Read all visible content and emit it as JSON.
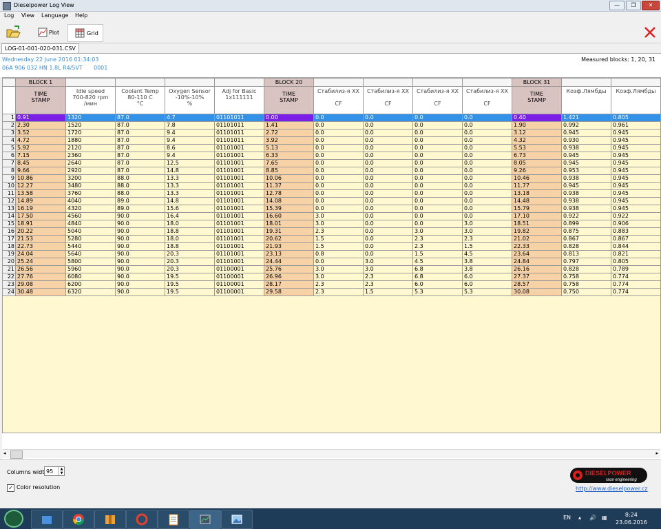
{
  "window": {
    "title": "Dieselpower Log View",
    "minimize": "—",
    "maximize": "❐",
    "close": "✕"
  },
  "menu": [
    "Log",
    "View",
    "Language",
    "Help"
  ],
  "toolbar": {
    "plot": "Plot",
    "grid": "Grid"
  },
  "file_tab": "LOG-01-001-020-031.CSV",
  "info": {
    "date": "Wednesday 22 June 2016 01:34:03",
    "engine": "06A 906 032 HN  1.8L R4/5VT",
    "code": "0001",
    "measured": "Measured blocks: 1, 20, 31"
  },
  "colors": {
    "accent": "#3391e8",
    "timestamp_cell": "#f6d2a6",
    "block_header": "#d9c3c0",
    "selected_ts": "#7b1fe6",
    "value_cell": "#fff8d0"
  },
  "grid": {
    "blocks": {
      "b1": "BLOCK 1",
      "b20": "BLOCK 20",
      "b31": "BLOCK 31"
    },
    "headers": [
      [
        "TIME",
        "STAMP",
        ""
      ],
      [
        "Idle speed",
        "700-820 rpm",
        "/мин"
      ],
      [
        "Coolant Temp",
        "80-110 C",
        "°C"
      ],
      [
        "Oxygen Sensor",
        "-10%-10%",
        "%"
      ],
      [
        "Adj for Basic",
        "1x111111",
        ""
      ],
      [
        "TIME",
        "STAMP",
        ""
      ],
      [
        "Стабилиз-я ХХ",
        "",
        "CF"
      ],
      [
        "Стабилиз-я ХХ",
        "",
        "CF"
      ],
      [
        "Стабилиз-я ХХ",
        "",
        "CF"
      ],
      [
        "Стабилиз-я ХХ",
        "",
        "CF"
      ],
      [
        "TIME",
        "STAMP",
        ""
      ],
      [
        "Коэф.Лямбды",
        "",
        ""
      ],
      [
        "Коэф.Лямбды",
        "",
        ""
      ]
    ],
    "rows": [
      [
        "1",
        "0.91",
        "1320",
        "87.0",
        "4.7",
        "01101011",
        "0.00",
        "0.0",
        "0.0",
        "0.0",
        "0.0",
        "0.40",
        "1.421",
        "0.805"
      ],
      [
        "2",
        "2.30",
        "1520",
        "87.0",
        "7.8",
        "01101011",
        "1.41",
        "0.0",
        "0.0",
        "0.0",
        "0.0",
        "1.90",
        "0.992",
        "0.961"
      ],
      [
        "3",
        "3.52",
        "1720",
        "87.0",
        "9.4",
        "01101011",
        "2.72",
        "0.0",
        "0.0",
        "0.0",
        "0.0",
        "3.12",
        "0.945",
        "0.945"
      ],
      [
        "4",
        "4.72",
        "1880",
        "87.0",
        "9.4",
        "01101011",
        "3.92",
        "0.0",
        "0.0",
        "0.0",
        "0.0",
        "4.32",
        "0.930",
        "0.945"
      ],
      [
        "5",
        "5.92",
        "2120",
        "87.0",
        "8.6",
        "01101001",
        "5.13",
        "0.0",
        "0.0",
        "0.0",
        "0.0",
        "5.53",
        "0.938",
        "0.945"
      ],
      [
        "6",
        "7.15",
        "2360",
        "87.0",
        "9.4",
        "01101001",
        "6.33",
        "0.0",
        "0.0",
        "0.0",
        "0.0",
        "6.73",
        "0.945",
        "0.945"
      ],
      [
        "7",
        "8.45",
        "2640",
        "87.0",
        "12.5",
        "01101001",
        "7.65",
        "0.0",
        "0.0",
        "0.0",
        "0.0",
        "8.05",
        "0.945",
        "0.945"
      ],
      [
        "8",
        "9.66",
        "2920",
        "87.0",
        "14.8",
        "01101001",
        "8.85",
        "0.0",
        "0.0",
        "0.0",
        "0.0",
        "9.26",
        "0.953",
        "0.945"
      ],
      [
        "9",
        "10.86",
        "3200",
        "88.0",
        "13.3",
        "01101001",
        "10.06",
        "0.0",
        "0.0",
        "0.0",
        "0.0",
        "10.46",
        "0.938",
        "0.945"
      ],
      [
        "10",
        "12.27",
        "3480",
        "88.0",
        "13.3",
        "01101001",
        "11.37",
        "0.0",
        "0.0",
        "0.0",
        "0.0",
        "11.77",
        "0.945",
        "0.945"
      ],
      [
        "11",
        "13.58",
        "3760",
        "88.0",
        "13.3",
        "01101001",
        "12.78",
        "0.0",
        "0.0",
        "0.0",
        "0.0",
        "13.18",
        "0.938",
        "0.945"
      ],
      [
        "12",
        "14.89",
        "4040",
        "89.0",
        "14.8",
        "01101001",
        "14.08",
        "0.0",
        "0.0",
        "0.0",
        "0.0",
        "14.48",
        "0.938",
        "0.945"
      ],
      [
        "13",
        "16.19",
        "4320",
        "89.0",
        "15.6",
        "01101001",
        "15.39",
        "0.0",
        "0.0",
        "0.0",
        "0.0",
        "15.79",
        "0.938",
        "0.945"
      ],
      [
        "14",
        "17.50",
        "4560",
        "90.0",
        "16.4",
        "01101001",
        "16.60",
        "3.0",
        "0.0",
        "0.0",
        "0.0",
        "17.10",
        "0.922",
        "0.922"
      ],
      [
        "15",
        "18.91",
        "4840",
        "90.0",
        "18.0",
        "01101001",
        "18.01",
        "3.0",
        "0.0",
        "0.0",
        "3.0",
        "18.51",
        "0.899",
        "0.906"
      ],
      [
        "16",
        "20.22",
        "5040",
        "90.0",
        "18.8",
        "01101001",
        "19.31",
        "2.3",
        "0.0",
        "3.0",
        "3.0",
        "19.82",
        "0.875",
        "0.883"
      ],
      [
        "17",
        "21.53",
        "5280",
        "90.0",
        "18.0",
        "01101001",
        "20.62",
        "1.5",
        "0.0",
        "2.3",
        "2.3",
        "21.02",
        "0.867",
        "0.867"
      ],
      [
        "18",
        "22.73",
        "5440",
        "90.0",
        "18.8",
        "01101001",
        "21.93",
        "1.5",
        "0.0",
        "2.3",
        "1.5",
        "22.33",
        "0.828",
        "0.844"
      ],
      [
        "19",
        "24.04",
        "5640",
        "90.0",
        "20.3",
        "01101001",
        "23.13",
        "0.8",
        "0.0",
        "1.5",
        "4.5",
        "23.64",
        "0.813",
        "0.821"
      ],
      [
        "20",
        "25.24",
        "5800",
        "90.0",
        "20.3",
        "01101001",
        "24.44",
        "0.0",
        "3.0",
        "4.5",
        "3.8",
        "24.84",
        "0.797",
        "0.805"
      ],
      [
        "21",
        "26.56",
        "5960",
        "90.0",
        "20.3",
        "01100001",
        "25.76",
        "3.0",
        "3.0",
        "6.8",
        "3.8",
        "26.16",
        "0.828",
        "0.789"
      ],
      [
        "22",
        "27.76",
        "6080",
        "90.0",
        "19.5",
        "01100001",
        "26.96",
        "3.0",
        "2.3",
        "6.8",
        "6.0",
        "27.37",
        "0.758",
        "0.774"
      ],
      [
        "23",
        "29.08",
        "6200",
        "90.0",
        "19.5",
        "01100001",
        "28.17",
        "2.3",
        "2.3",
        "6.0",
        "6.0",
        "28.57",
        "0.758",
        "0.774"
      ],
      [
        "24",
        "30.48",
        "6320",
        "90.0",
        "19.5",
        "01100001",
        "29.58",
        "2.3",
        "1.5",
        "5.3",
        "5.3",
        "30.08",
        "0.750",
        "0.774"
      ]
    ]
  },
  "bottom": {
    "columns_width_label": "Columns width:",
    "columns_width_value": "95",
    "color_resolution": "Color resolution",
    "link": "http://www.dieselpower.cz",
    "logo_main": "DIESELPOWER",
    "logo_sub": "race engineering"
  },
  "taskbar": {
    "lang": "EN",
    "time": "8:24",
    "date": "23.06.2016"
  }
}
